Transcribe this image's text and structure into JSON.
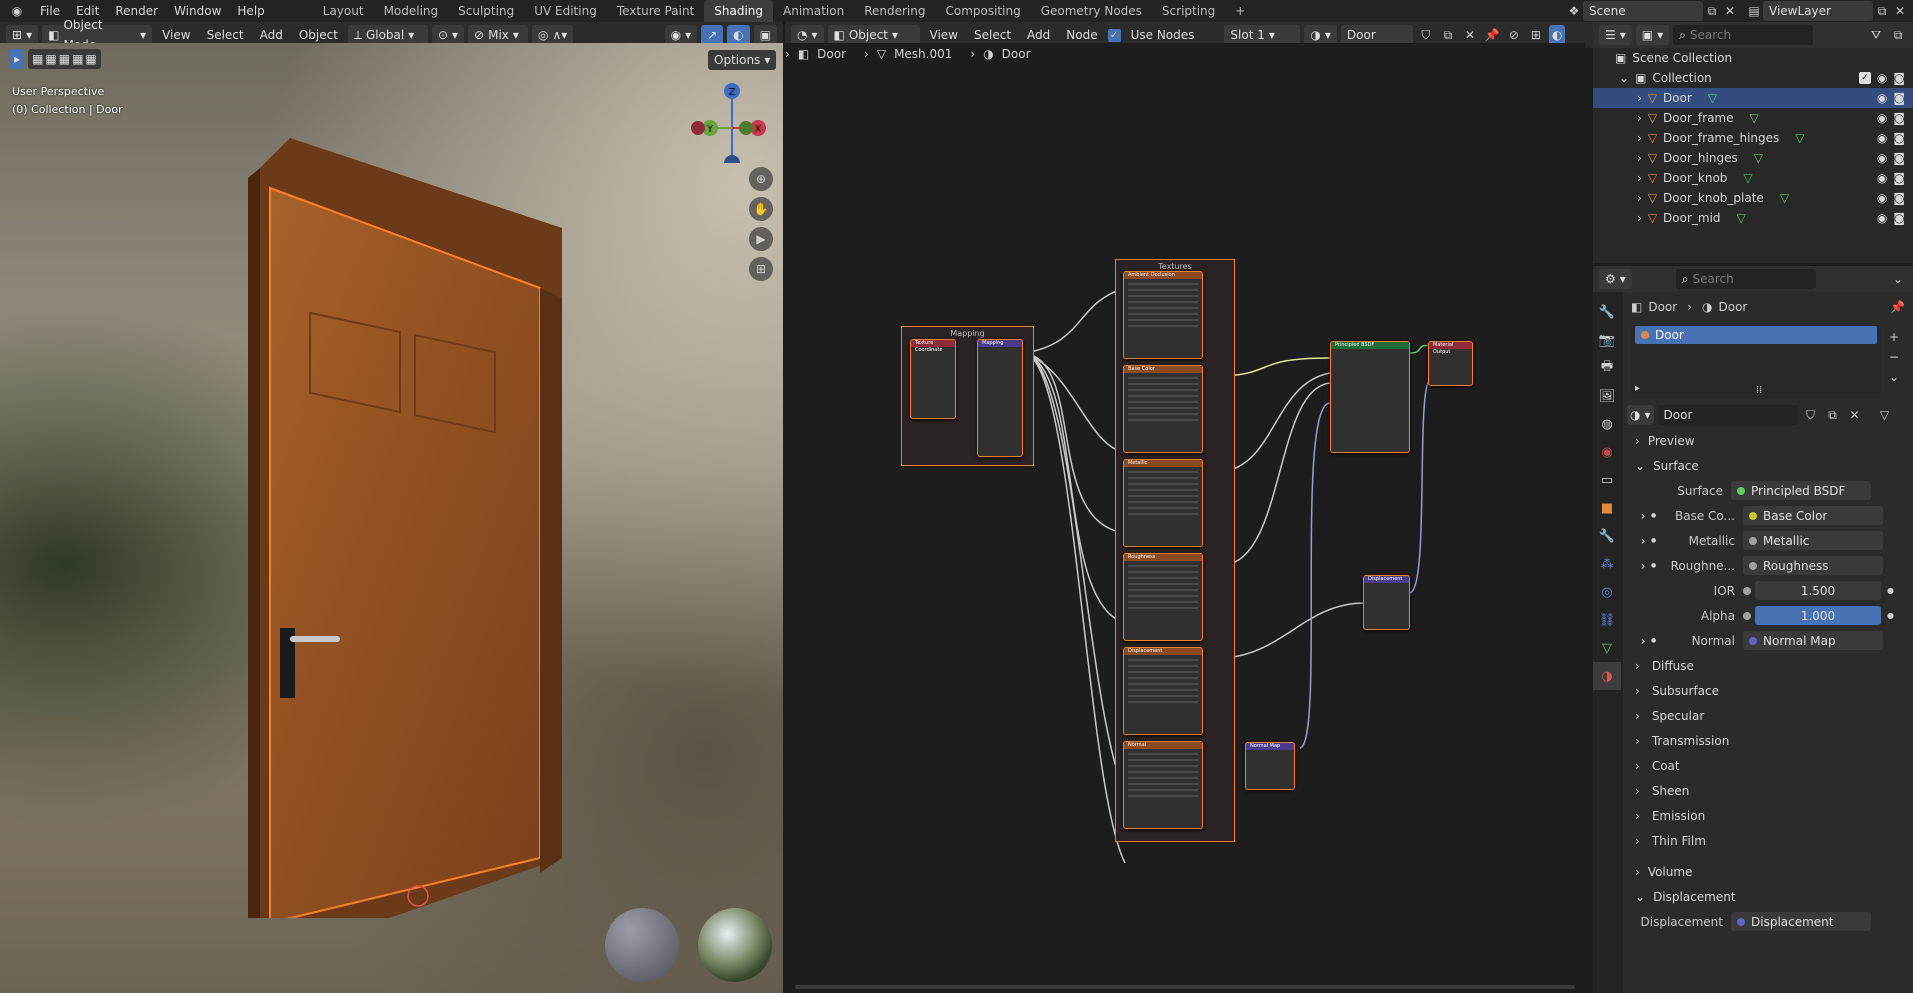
{
  "topbar": {
    "menus": [
      "File",
      "Edit",
      "Render",
      "Window",
      "Help"
    ],
    "workspaces": [
      "Layout",
      "Modeling",
      "Sculpting",
      "UV Editing",
      "Texture Paint",
      "Shading",
      "Animation",
      "Rendering",
      "Compositing",
      "Geometry Nodes",
      "Scripting"
    ],
    "active_workspace": "Shading",
    "add_tab": "+",
    "scene": "Scene",
    "view_layer": "ViewLayer"
  },
  "viewport": {
    "mode": "Object Mode",
    "menus": [
      "View",
      "Select",
      "Add",
      "Object"
    ],
    "transform_orientation": "Global",
    "pivot": "Mix",
    "options": "Options",
    "overlay_line1": "User Perspective",
    "overlay_line2": "(0) Collection | Door",
    "gizmo": {
      "z": "Z",
      "y": "Y",
      "x": "X"
    }
  },
  "node_editor": {
    "editor_type": "Object",
    "menus": [
      "View",
      "Select",
      "Add",
      "Node"
    ],
    "use_nodes_label": "Use Nodes",
    "slot": "Slot 1",
    "material": "Door",
    "breadcrumb": [
      "Door",
      "Mesh.001",
      "Door"
    ],
    "frames": {
      "mapping": "Mapping",
      "textures": "Textures"
    },
    "texture_nodes": [
      "Ambient Occlusion",
      "Base Color",
      "Metallic",
      "Roughness",
      "Displacement",
      "Normal"
    ],
    "other_nodes": {
      "tex_coord": "Texture Coordinate",
      "mapping": "Mapping",
      "bsdf": "Principled BSDF",
      "output": "Material Output",
      "displacement": "Displacement",
      "normal_map": "Normal Map"
    }
  },
  "outliner": {
    "search_placeholder": "Search",
    "scene_collection": "Scene Collection",
    "collection": "Collection",
    "objects": [
      "Door",
      "Door_frame",
      "Door_frame_hinges",
      "Door_hinges",
      "Door_knob",
      "Door_knob_plate",
      "Door_mid"
    ],
    "selected": "Door"
  },
  "properties": {
    "search_placeholder": "Search",
    "breadcrumb": [
      "Door",
      "Door"
    ],
    "material_slot": "Door",
    "material_name": "Door",
    "sections": {
      "preview": "Preview",
      "surface": "Surface",
      "volume": "Volume",
      "displacement": "Displacement"
    },
    "surface_rows": [
      {
        "label": "Surface",
        "value": "Principled BSDF",
        "color": "#63c763"
      },
      {
        "label": "Base Co...",
        "value": "Base Color",
        "color": "#c7c729"
      },
      {
        "label": "Metallic",
        "value": "Metallic",
        "color": "#a1a1a1"
      },
      {
        "label": "Roughne...",
        "value": "Roughness",
        "color": "#a1a1a1"
      }
    ],
    "ior": {
      "label": "IOR",
      "value": "1.500"
    },
    "alpha": {
      "label": "Alpha",
      "value": "1.000"
    },
    "normal": {
      "label": "Normal",
      "value": "Normal Map",
      "color": "#6363c7"
    },
    "subpanels": [
      "Diffuse",
      "Subsurface",
      "Specular",
      "Transmission",
      "Coat",
      "Sheen",
      "Emission",
      "Thin Film"
    ],
    "displacement_row": {
      "label": "Displacement",
      "value": "Displacement",
      "color": "#6363c7"
    }
  },
  "colors": {
    "accent": "#4772b3",
    "selection_outline": "#ff7f28",
    "active_tab": "#3d3d3d"
  }
}
